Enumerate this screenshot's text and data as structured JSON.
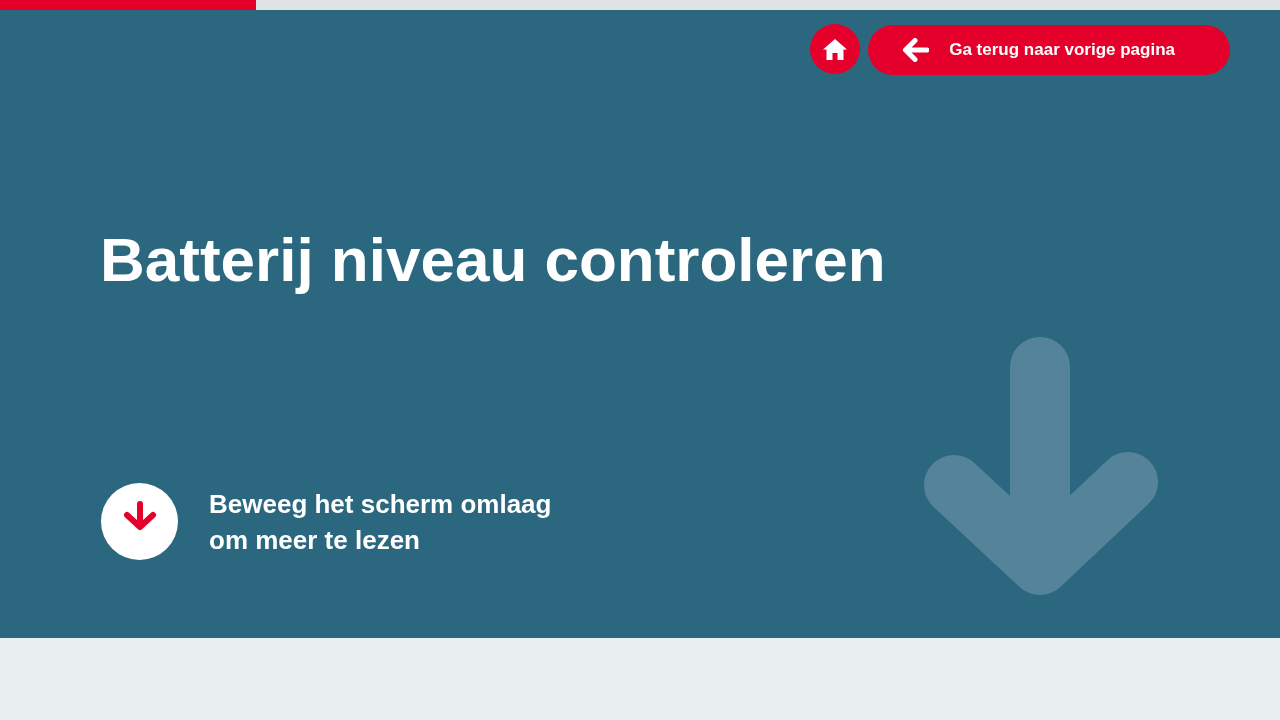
{
  "progress": {
    "level": 0.2
  },
  "nav": {
    "back_button": {
      "label": "Ga terug naar vorige pagina"
    }
  },
  "hero": {
    "title": "Batterij niveau controleren",
    "scroll_hint": "Beweeg het scherm omlaag om meer te lezen"
  }
}
